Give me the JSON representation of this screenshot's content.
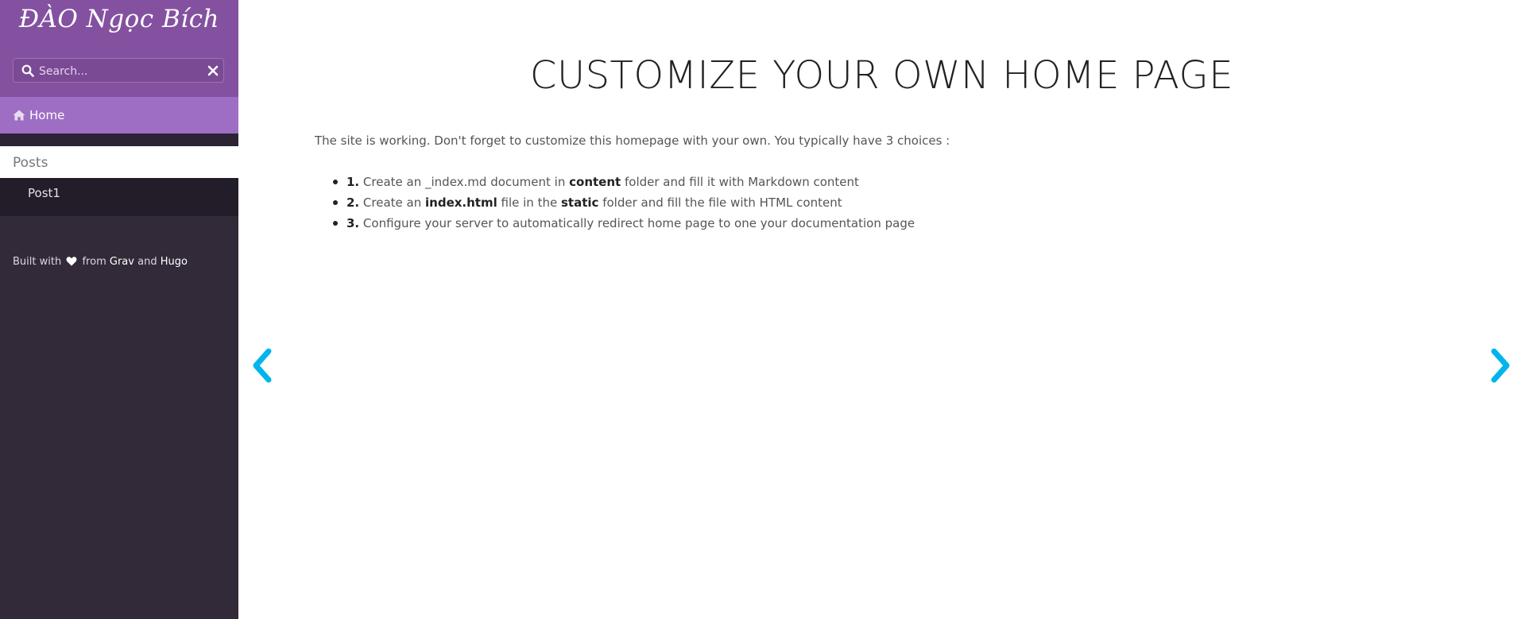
{
  "sidebar": {
    "logo": "ĐÀO Ngọc Bích",
    "search": {
      "placeholder": "Search...",
      "value": ""
    },
    "home": {
      "label": "Home",
      "icon": "home-icon"
    },
    "section_title": "Posts",
    "items": [
      {
        "label": "Post1"
      }
    ],
    "footer": {
      "prefix": "Built with",
      "heart": "heart-icon",
      "from": "from",
      "link1": "Grav",
      "and": "and",
      "link2": "Hugo"
    }
  },
  "main": {
    "title": "CUSTOMIZE YOUR OWN HOME PAGE",
    "intro": "The site is working. Don't forget to customize this homepage with your own. You typically have 3 choices :",
    "choices": [
      {
        "num": "1.",
        "t1": "Create an _index.md document in",
        "bold": "content",
        "t2": "folder and fill it with Markdown content"
      },
      {
        "num": "2.",
        "t1": "Create an",
        "bold": "index.html",
        "t2": "file in the",
        "bold2": "static",
        "t3": "folder and fill the file with HTML content"
      },
      {
        "num": "3.",
        "t1": "Configure your server to automatically redirect home page to one your documentation page"
      }
    ]
  },
  "nav": {
    "prev_icon": "chevron-left-icon",
    "next_icon": "chevron-right-icon"
  },
  "colors": {
    "sidebar_header": "#8451a1",
    "sidebar_bg": "#322a38",
    "home_active": "#9e6ec5",
    "nav_arrow": "#00b4ec"
  }
}
